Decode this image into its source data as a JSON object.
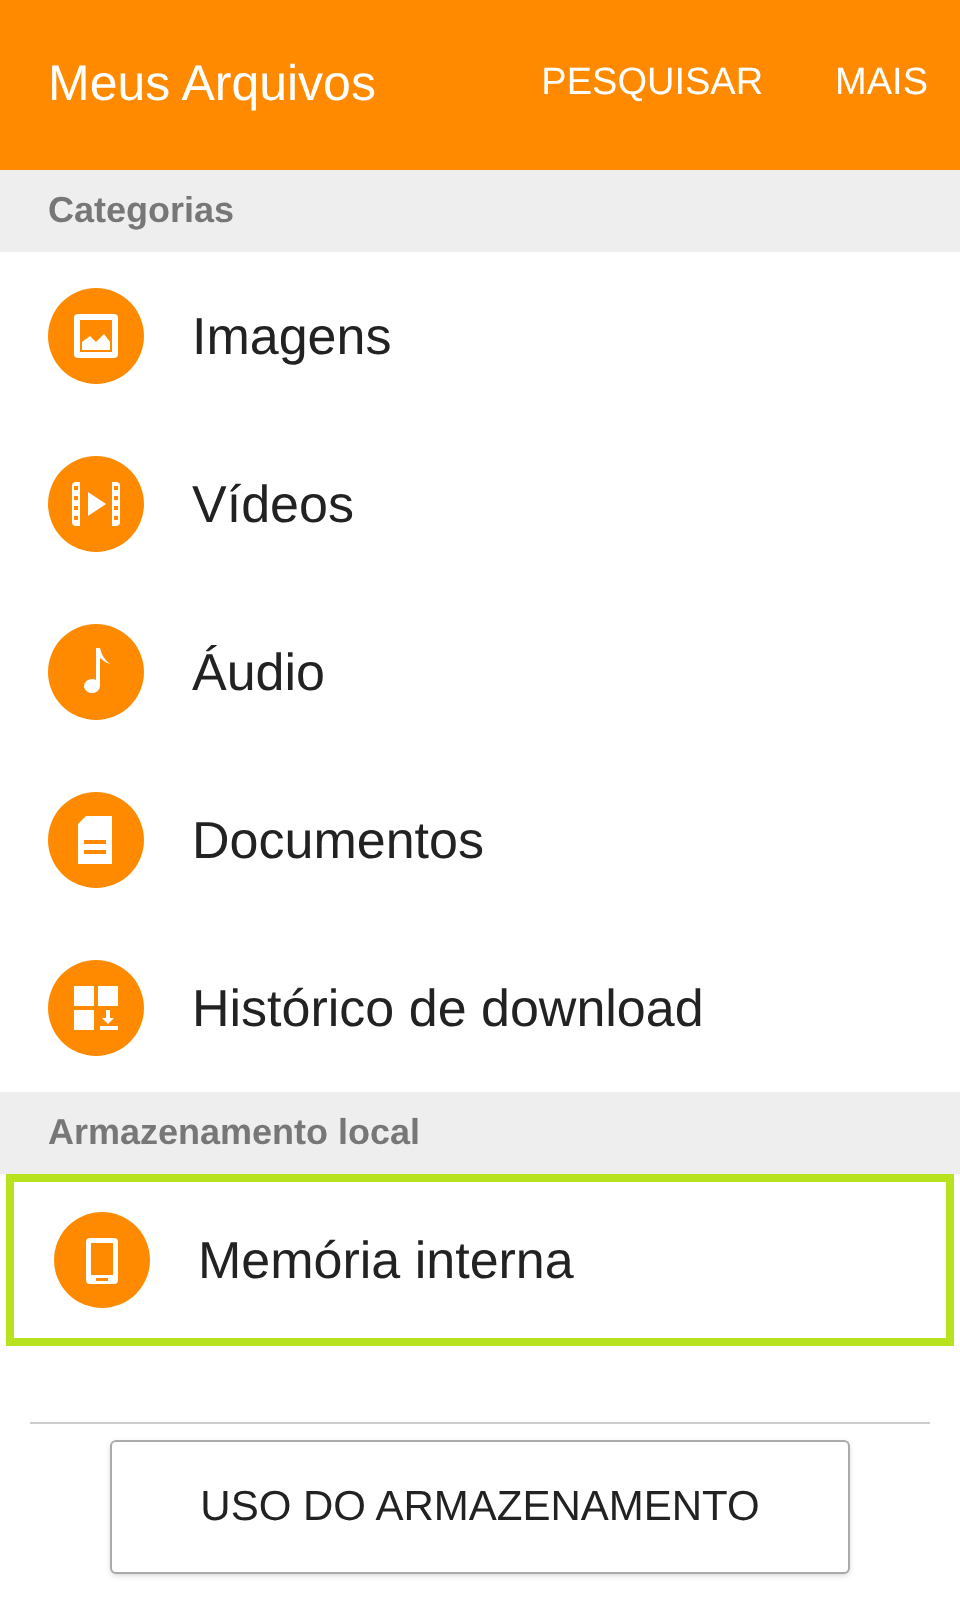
{
  "app_bar": {
    "title": "Meus Arquivos",
    "actions": [
      "PESQUISAR",
      "MAIS"
    ]
  },
  "sections": [
    {
      "header": "Categorias",
      "items": [
        {
          "label": "Imagens",
          "kind": "image",
          "selected": false
        },
        {
          "label": "Vídeos",
          "kind": "video",
          "selected": false
        },
        {
          "label": "Áudio",
          "kind": "audio",
          "selected": false
        },
        {
          "label": "Documentos",
          "kind": "document",
          "selected": false
        },
        {
          "label": "Histórico de download",
          "kind": "download",
          "selected": false
        }
      ]
    },
    {
      "header": "Armazenamento local",
      "items": [
        {
          "label": "Memória interna",
          "kind": "device",
          "selected": true
        }
      ]
    }
  ],
  "footer_button": "USO DO ARMAZENAMENTO"
}
